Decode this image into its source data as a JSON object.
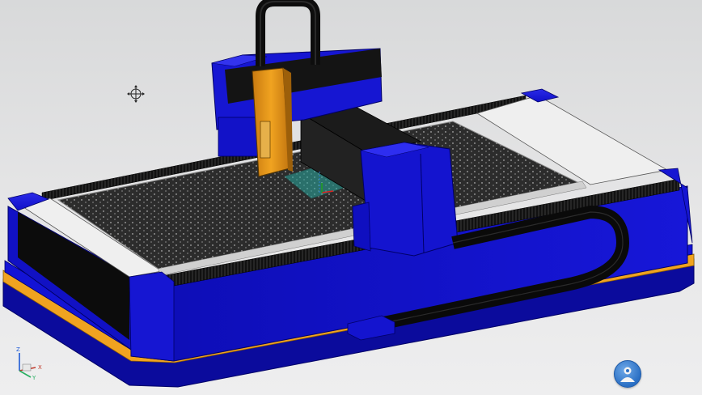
{
  "viewport": {
    "title": "",
    "colors": {
      "frame": "#1313d6",
      "frame_dark": "#0b0b9c",
      "frame_outline": "#000066",
      "base_stripe": "#f0a320",
      "bed": "#2c2c2c",
      "bed_dots": "#e8e8e8",
      "bellows": "#111111",
      "end_cap": "#efefef",
      "carriage_plate": "#d88a14",
      "cable": "#111111",
      "workpiece": "#2aa9a0"
    }
  },
  "model": {
    "name": "laser-cutting-machine",
    "parts": [
      "base-frame",
      "cutting-bed",
      "gantry",
      "z-axis-carriage",
      "cable-chain",
      "end-caps",
      "bellows"
    ]
  },
  "axis_triad": {
    "x_label": "X",
    "y_label": "Y",
    "z_label": "Z"
  },
  "controls": {
    "user_button_icon": "user-avatar-icon",
    "cursor_icon": "crosshair-move-icon"
  }
}
